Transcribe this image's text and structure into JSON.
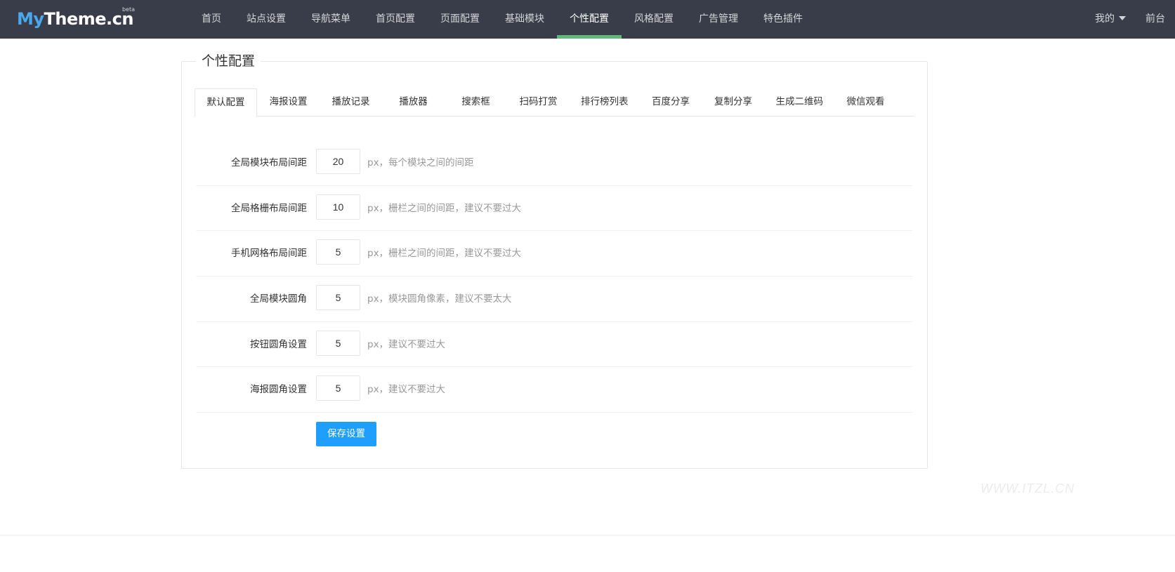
{
  "brand": {
    "logo_part1": "My",
    "logo_part2": "Theme.cn",
    "badge": "beta",
    "accent_color": "#49a9ee"
  },
  "nav": {
    "items": [
      {
        "label": "首页"
      },
      {
        "label": "站点设置"
      },
      {
        "label": "导航菜单"
      },
      {
        "label": "首页配置"
      },
      {
        "label": "页面配置"
      },
      {
        "label": "基础模块"
      },
      {
        "label": "个性配置",
        "active": true
      },
      {
        "label": "风格配置"
      },
      {
        "label": "广告管理"
      },
      {
        "label": "特色插件"
      }
    ],
    "user_menu": "我的",
    "frontend_link": "前台",
    "active_indicator_color": "#5fb878"
  },
  "panel": {
    "title": "个性配置",
    "tabs": [
      {
        "label": "默认配置",
        "active": true
      },
      {
        "label": "海报设置"
      },
      {
        "label": "播放记录"
      },
      {
        "label": "播放器"
      },
      {
        "label": "搜索框"
      },
      {
        "label": "扫码打赏"
      },
      {
        "label": "排行榜列表"
      },
      {
        "label": "百度分享"
      },
      {
        "label": "复制分享"
      },
      {
        "label": "生成二维码"
      },
      {
        "label": "微信观看"
      }
    ]
  },
  "form": {
    "rows": [
      {
        "label": "全局模块布局间距",
        "value": "20",
        "tip": "px，每个模块之间的间距"
      },
      {
        "label": "全局格栅布局间距",
        "value": "10",
        "tip": "px，栅栏之间的间距，建议不要过大"
      },
      {
        "label": "手机网格布局间距",
        "value": "5",
        "tip": "px，栅栏之间的间距，建议不要过大"
      },
      {
        "label": "全局模块圆角",
        "value": "5",
        "tip": "px，模块圆角像素，建议不要太大"
      },
      {
        "label": "按钮圆角设置",
        "value": "5",
        "tip": "px，建议不要过大"
      },
      {
        "label": "海报圆角设置",
        "value": "5",
        "tip": "px，建议不要过大"
      }
    ],
    "save_label": "保存设置",
    "button_color": "#1e9fff"
  },
  "watermark": "WWW.ITZL.CN"
}
